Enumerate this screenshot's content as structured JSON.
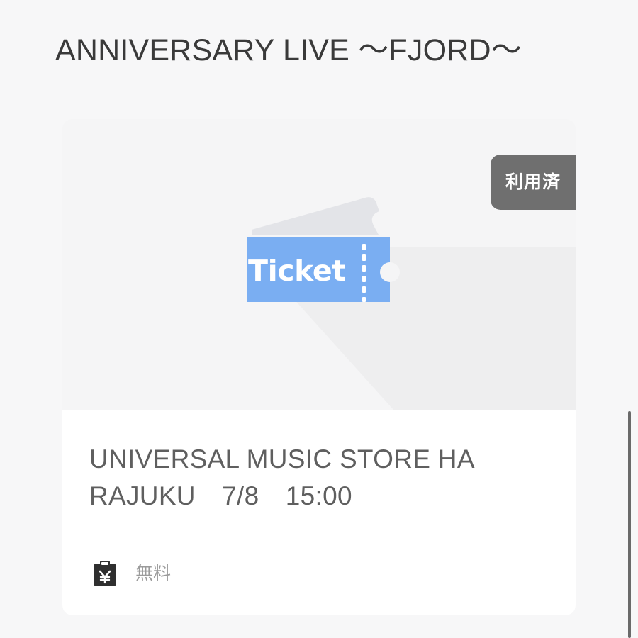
{
  "page": {
    "title": "ANNIVERSARY LIVE 〜FJORD〜"
  },
  "ticket": {
    "status_badge": "利用済",
    "icon_label": "Ticket",
    "event_title": "UNIVERSAL MUSIC STORE HA\nRAJUKU　7/8　15:00",
    "price": "無料",
    "price_icon": "receipt-yen-icon",
    "ticket_icon": "ticket-icon"
  },
  "colors": {
    "background": "#f7f7f8",
    "ticket_blue": "#7aaef2",
    "badge_gray": "#6f6f6f",
    "title_text": "#3a3a3a",
    "secondary_text": "#9b9b9b"
  }
}
